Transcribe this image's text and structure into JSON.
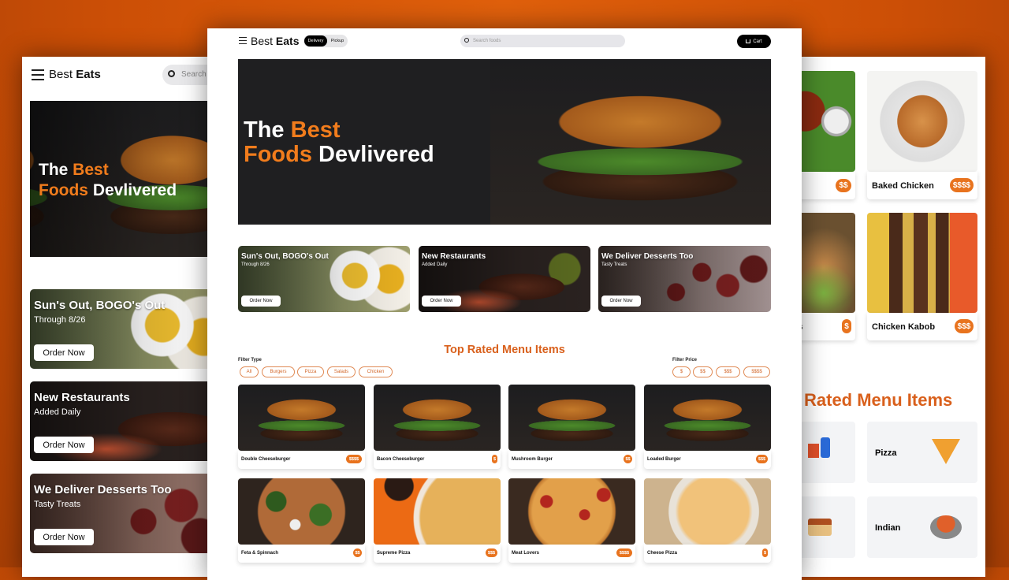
{
  "brand": {
    "first": "Best",
    "second": "Eats"
  },
  "nav": {
    "delivery": "Delivery",
    "pickup": "Pickup",
    "search_placeholder": "Search foods",
    "search_short": "Search",
    "cart": "Cart"
  },
  "hero": {
    "line1_a": "The ",
    "line1_b": "Best",
    "line2_a": "Foods",
    "line2_b": " Devlivered"
  },
  "promos": [
    {
      "title": "Sun's Out, BOGO's Out",
      "subtitle": "Through 8/26",
      "button": "Order Now"
    },
    {
      "title": "New Restaurants",
      "subtitle": "Added Daily",
      "button": "Order Now"
    },
    {
      "title": "We Deliver Desserts Too",
      "subtitle": "Tasty Treats",
      "button": "Order Now"
    }
  ],
  "menu": {
    "heading": "Top Rated Menu Items",
    "heading_partial": "Rated Menu Items",
    "filter_type_label": "Filter Type",
    "filter_types": [
      "All",
      "Burgers",
      "Pizza",
      "Salads",
      "Chicken"
    ],
    "filter_price_label": "Filter Price",
    "filter_prices": [
      "$",
      "$$",
      "$$$",
      "$$$$"
    ],
    "items": [
      {
        "name": "Double Cheeseburger",
        "price": "$$$$"
      },
      {
        "name": "Bacon Cheeseburger",
        "price": "$"
      },
      {
        "name": "Mushroom Burger",
        "price": "$$"
      },
      {
        "name": "Loaded Burger",
        "price": "$$$"
      },
      {
        "name": "Feta & Spinnach",
        "price": "$$"
      },
      {
        "name": "Supreme Pizza",
        "price": "$$$"
      },
      {
        "name": "Meat Lovers",
        "price": "$$$$"
      },
      {
        "name": "Cheese Pizza",
        "price": "$"
      }
    ]
  },
  "right": {
    "items": [
      {
        "name": "",
        "price": "$$"
      },
      {
        "name": "Baked Chicken",
        "price": "$$$$"
      },
      {
        "name": "ers",
        "price": "$"
      },
      {
        "name": "Chicken Kabob",
        "price": "$$$"
      }
    ],
    "categories": [
      "Pizza",
      "Indian"
    ]
  },
  "colors": {
    "accent": "#e8731e",
    "heading": "#d9601c",
    "background": "#cc4f06"
  }
}
